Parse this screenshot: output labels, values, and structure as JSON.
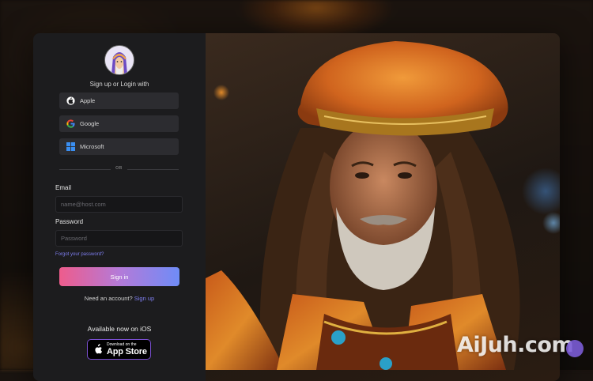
{
  "login": {
    "heading": "Sign up or Login with",
    "providers": [
      {
        "label": "Apple",
        "icon": "apple-icon"
      },
      {
        "label": "Google",
        "icon": "google-icon"
      },
      {
        "label": "Microsoft",
        "icon": "microsoft-icon"
      }
    ],
    "divider": "OR",
    "email_label": "Email",
    "email_placeholder": "name@host.com",
    "password_label": "Password",
    "password_placeholder": "Password",
    "forgot": "Forgot your password?",
    "signin": "Sign in",
    "account_prompt": "Need an account?",
    "signup": "Sign up",
    "ios_text": "Available now on iOS",
    "appstore_small": "Download on the",
    "appstore_big": "App Store"
  },
  "watermark": "AiJuh.com",
  "colors": {
    "panel": "#1c1c1e",
    "link": "#7e7ef0",
    "signin_gradient_start": "#ee5c8c",
    "signin_gradient_end": "#6f8cf7"
  }
}
